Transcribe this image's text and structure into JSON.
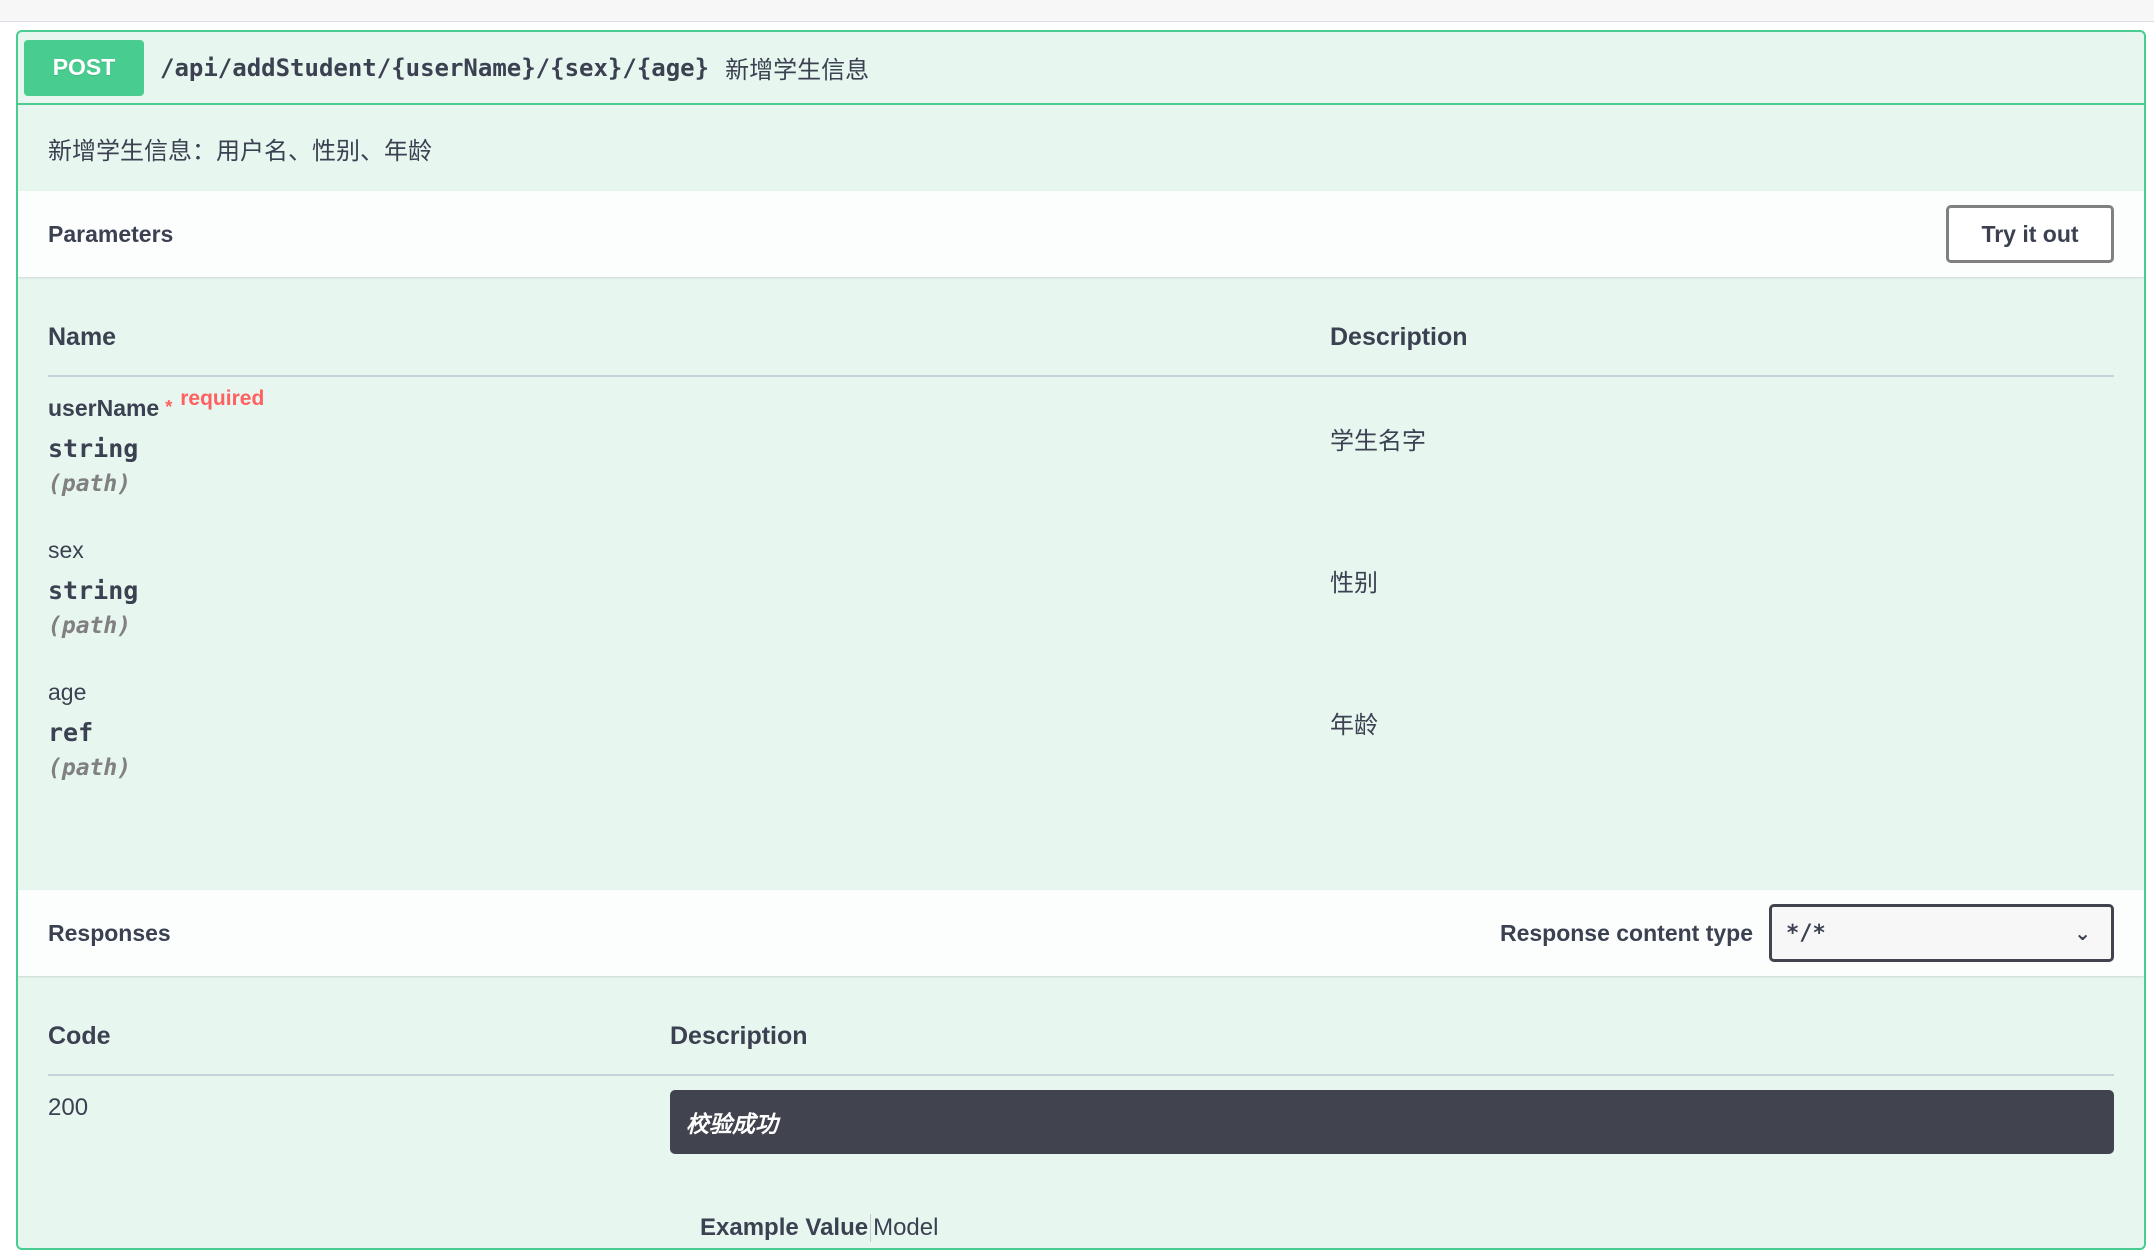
{
  "operation": {
    "method": "POST",
    "path": "/api/addStudent/{userName}/{sex}/{age}",
    "summary": "新增学生信息",
    "description": "新增学生信息：用户名、性别、年龄"
  },
  "parameters": {
    "title": "Parameters",
    "try_label": "Try it out",
    "col_name": "Name",
    "col_desc": "Description",
    "items": [
      {
        "name": "userName",
        "star": "*",
        "required": "required",
        "type": "string",
        "in": "(path)",
        "description": "学生名字"
      },
      {
        "name": "sex",
        "type": "string",
        "in": "(path)",
        "description": "性别"
      },
      {
        "name": "age",
        "type": "ref",
        "in": "(path)",
        "description": "年龄"
      }
    ]
  },
  "responses": {
    "title": "Responses",
    "content_type_label": "Response content type",
    "content_type_value": "*/*",
    "col_code": "Code",
    "col_desc": "Description",
    "items": [
      {
        "code": "200",
        "description": "校验成功"
      }
    ],
    "tab_example": "Example Value",
    "tab_model": "Model"
  },
  "colors": {
    "post_green": "#49cc90",
    "post_bg": "#e8f6f0",
    "required_red": "#ff6060",
    "dark_box": "#41444e"
  }
}
